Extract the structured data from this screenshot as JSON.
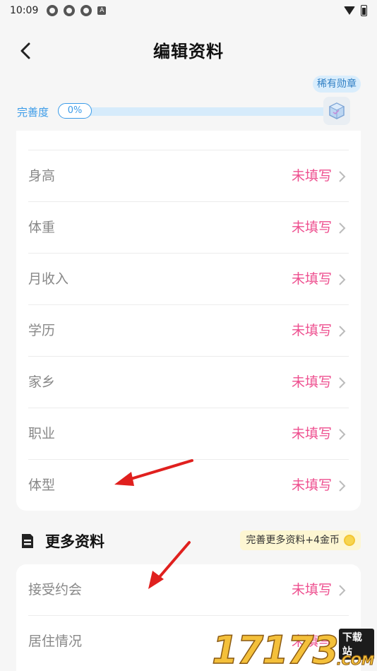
{
  "status_bar": {
    "time": "10:09",
    "icons": [
      "app-notification-icon",
      "app-notification-icon",
      "app-notification-icon",
      "a-notification-icon",
      "wifi-icon",
      "battery-icon"
    ],
    "a_glyph": "A"
  },
  "header": {
    "title": "编辑资料",
    "back_icon": "chevron-left-icon"
  },
  "progress": {
    "label": "完善度",
    "percent_text": "0%",
    "percent_value": 0,
    "rare_badge": "稀有勋章",
    "medal_icon": "cube-medal-icon"
  },
  "basic_rows": [
    {
      "label": "身高",
      "value": "未填写"
    },
    {
      "label": "体重",
      "value": "未填写"
    },
    {
      "label": "月收入",
      "value": "未填写"
    },
    {
      "label": "学历",
      "value": "未填写"
    },
    {
      "label": "家乡",
      "value": "未填写"
    },
    {
      "label": "职业",
      "value": "未填写"
    },
    {
      "label": "体型",
      "value": "未填写"
    }
  ],
  "more_section": {
    "title": "更多资料",
    "icon": "document-icon",
    "reward": "完善更多资料+4金币",
    "reward_icon": "coin-icon",
    "rows": [
      {
        "label": "接受约会",
        "value": "未填写"
      },
      {
        "label": "居住情况",
        "value": "未填写"
      }
    ]
  },
  "watermark": {
    "digits": "17173",
    "tag": "下载站",
    "suffix": ".COM"
  },
  "colors": {
    "accent_blue": "#3b9be8",
    "value_pink": "#ee4f8f",
    "annotation_red": "#e0201e",
    "background": "#f6f6f6"
  }
}
